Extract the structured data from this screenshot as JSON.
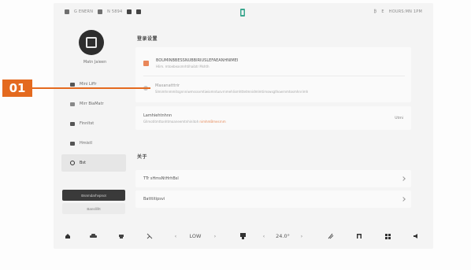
{
  "status_bar": {
    "left_items": [
      "G ENERN",
      "N 5894"
    ],
    "right_items": [
      "₿",
      "E",
      "HOURS:MN 1PM"
    ]
  },
  "profile": {
    "username": "Matn Jaieen"
  },
  "nav": {
    "items": [
      {
        "label": "Mini Liffr",
        "icon": "media-icon"
      },
      {
        "label": "Mirr BiaMatr",
        "icon": "vehicle-icon"
      },
      {
        "label": "Finnltst",
        "icon": "navigation-icon"
      },
      {
        "label": "Hmistl",
        "icon": "display-icon"
      },
      {
        "label": "Bst",
        "icon": "settings-icon"
      }
    ],
    "active_index": 4
  },
  "sidebar_buttons": {
    "primary": "Bsnmdarhvpnot",
    "secondary": "Bansllifrt"
  },
  "content": {
    "section1_title": "登录设置",
    "card1": {
      "row1_title": "BOUMINBBESSNUBBIRIUSLEFAEANHNIMEI",
      "row1_sub": "Hlim. mtoebeasmrhtihaibtr Mshth",
      "row2_title": "Maxanatttrir",
      "row2_sub": "Slmimhnmmitsgnnniwmsssvmtiwiomntusvrnmehlismhttetmnidmlmtimswsgthowrnmtosmhnrimh"
    },
    "card2": {
      "title": "Lamhiehtnhnn",
      "sub": "Gllmotitmttonhtmoaneemtnhinitoh",
      "sub_accent": "nimhmBmesrnm",
      "right": "Utmi"
    },
    "section2_title": "关于",
    "card3": {
      "label": "TTr sHmsNtHrhBsl"
    },
    "card4": {
      "label": "Batttitipsvi"
    }
  },
  "dock": {
    "fan_label": "LOW",
    "temperature": "24.0°",
    "left_arrow": "‹",
    "right_arrow": "›"
  },
  "callout": {
    "label": "01",
    "color": "#e46a1f"
  }
}
